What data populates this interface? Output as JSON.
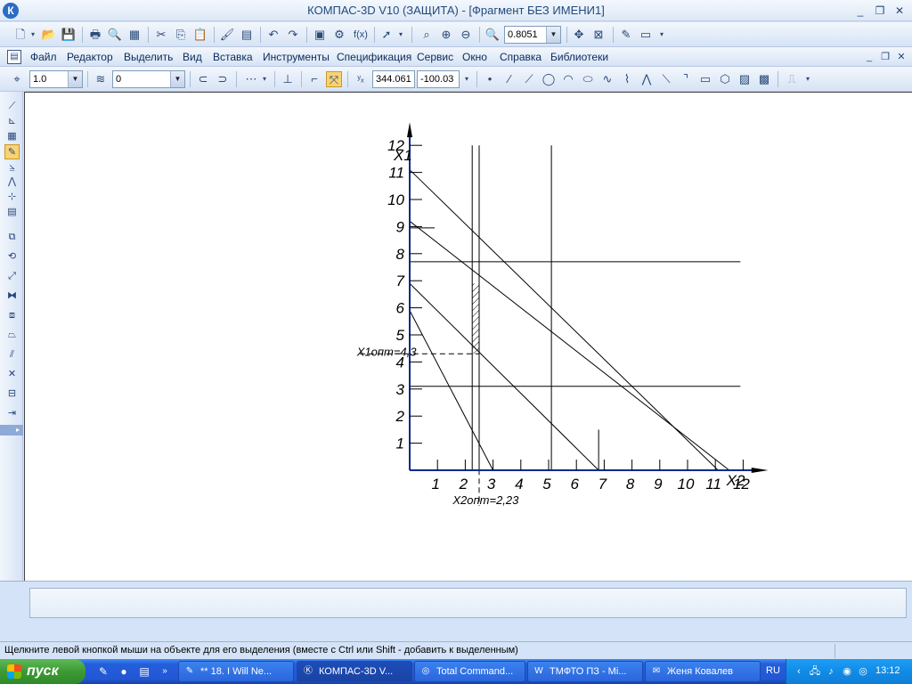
{
  "window": {
    "title": "КОМПАС-3D V10 (ЗАЩИТА) - [Фрагмент БЕЗ ИМЕНИ1]",
    "logo": "К",
    "controls": [
      "_",
      "❐",
      "✕"
    ]
  },
  "toolbar_standard": {
    "zoom_value": "0.8051"
  },
  "menu": {
    "items": [
      "Файл",
      "Редактор",
      "Выделить",
      "Вид",
      "Вставка",
      "Инструменты",
      "Спецификация",
      "Сервис",
      "Окно",
      "Справка",
      "Библиотеки"
    ]
  },
  "toolbar_current": {
    "step_value": "1.0",
    "layer_value": "0",
    "coord_x": "344.061",
    "coord_y": "-100.03"
  },
  "drawing": {
    "x_ticks": [
      "1",
      "2",
      "3",
      "4",
      "5",
      "6",
      "7",
      "8",
      "9",
      "10",
      "11",
      "12"
    ],
    "y_ticks": [
      "1",
      "2",
      "3",
      "4",
      "5",
      "6",
      "7",
      "8",
      "9",
      "10",
      "11",
      "12"
    ],
    "x_axis_label": "X2",
    "y_axis_label": "X1",
    "x1_opt_label": "X1опт=4,3",
    "x2_opt_label": "X2опт=2,23"
  },
  "status": {
    "hint": "Щелкните левой кнопкой мыши на объекте для его выделения (вместе с Ctrl или Shift - добавить к выделенным)"
  },
  "taskbar": {
    "start_label": "пуск",
    "tasks": [
      "** 18. I Will Ne...",
      "КОМПАС-3D V...",
      "Total Command...",
      "ТМФТО ПЗ - Mi...",
      "Женя Ковалев"
    ],
    "language": "RU",
    "clock": "13:12"
  }
}
